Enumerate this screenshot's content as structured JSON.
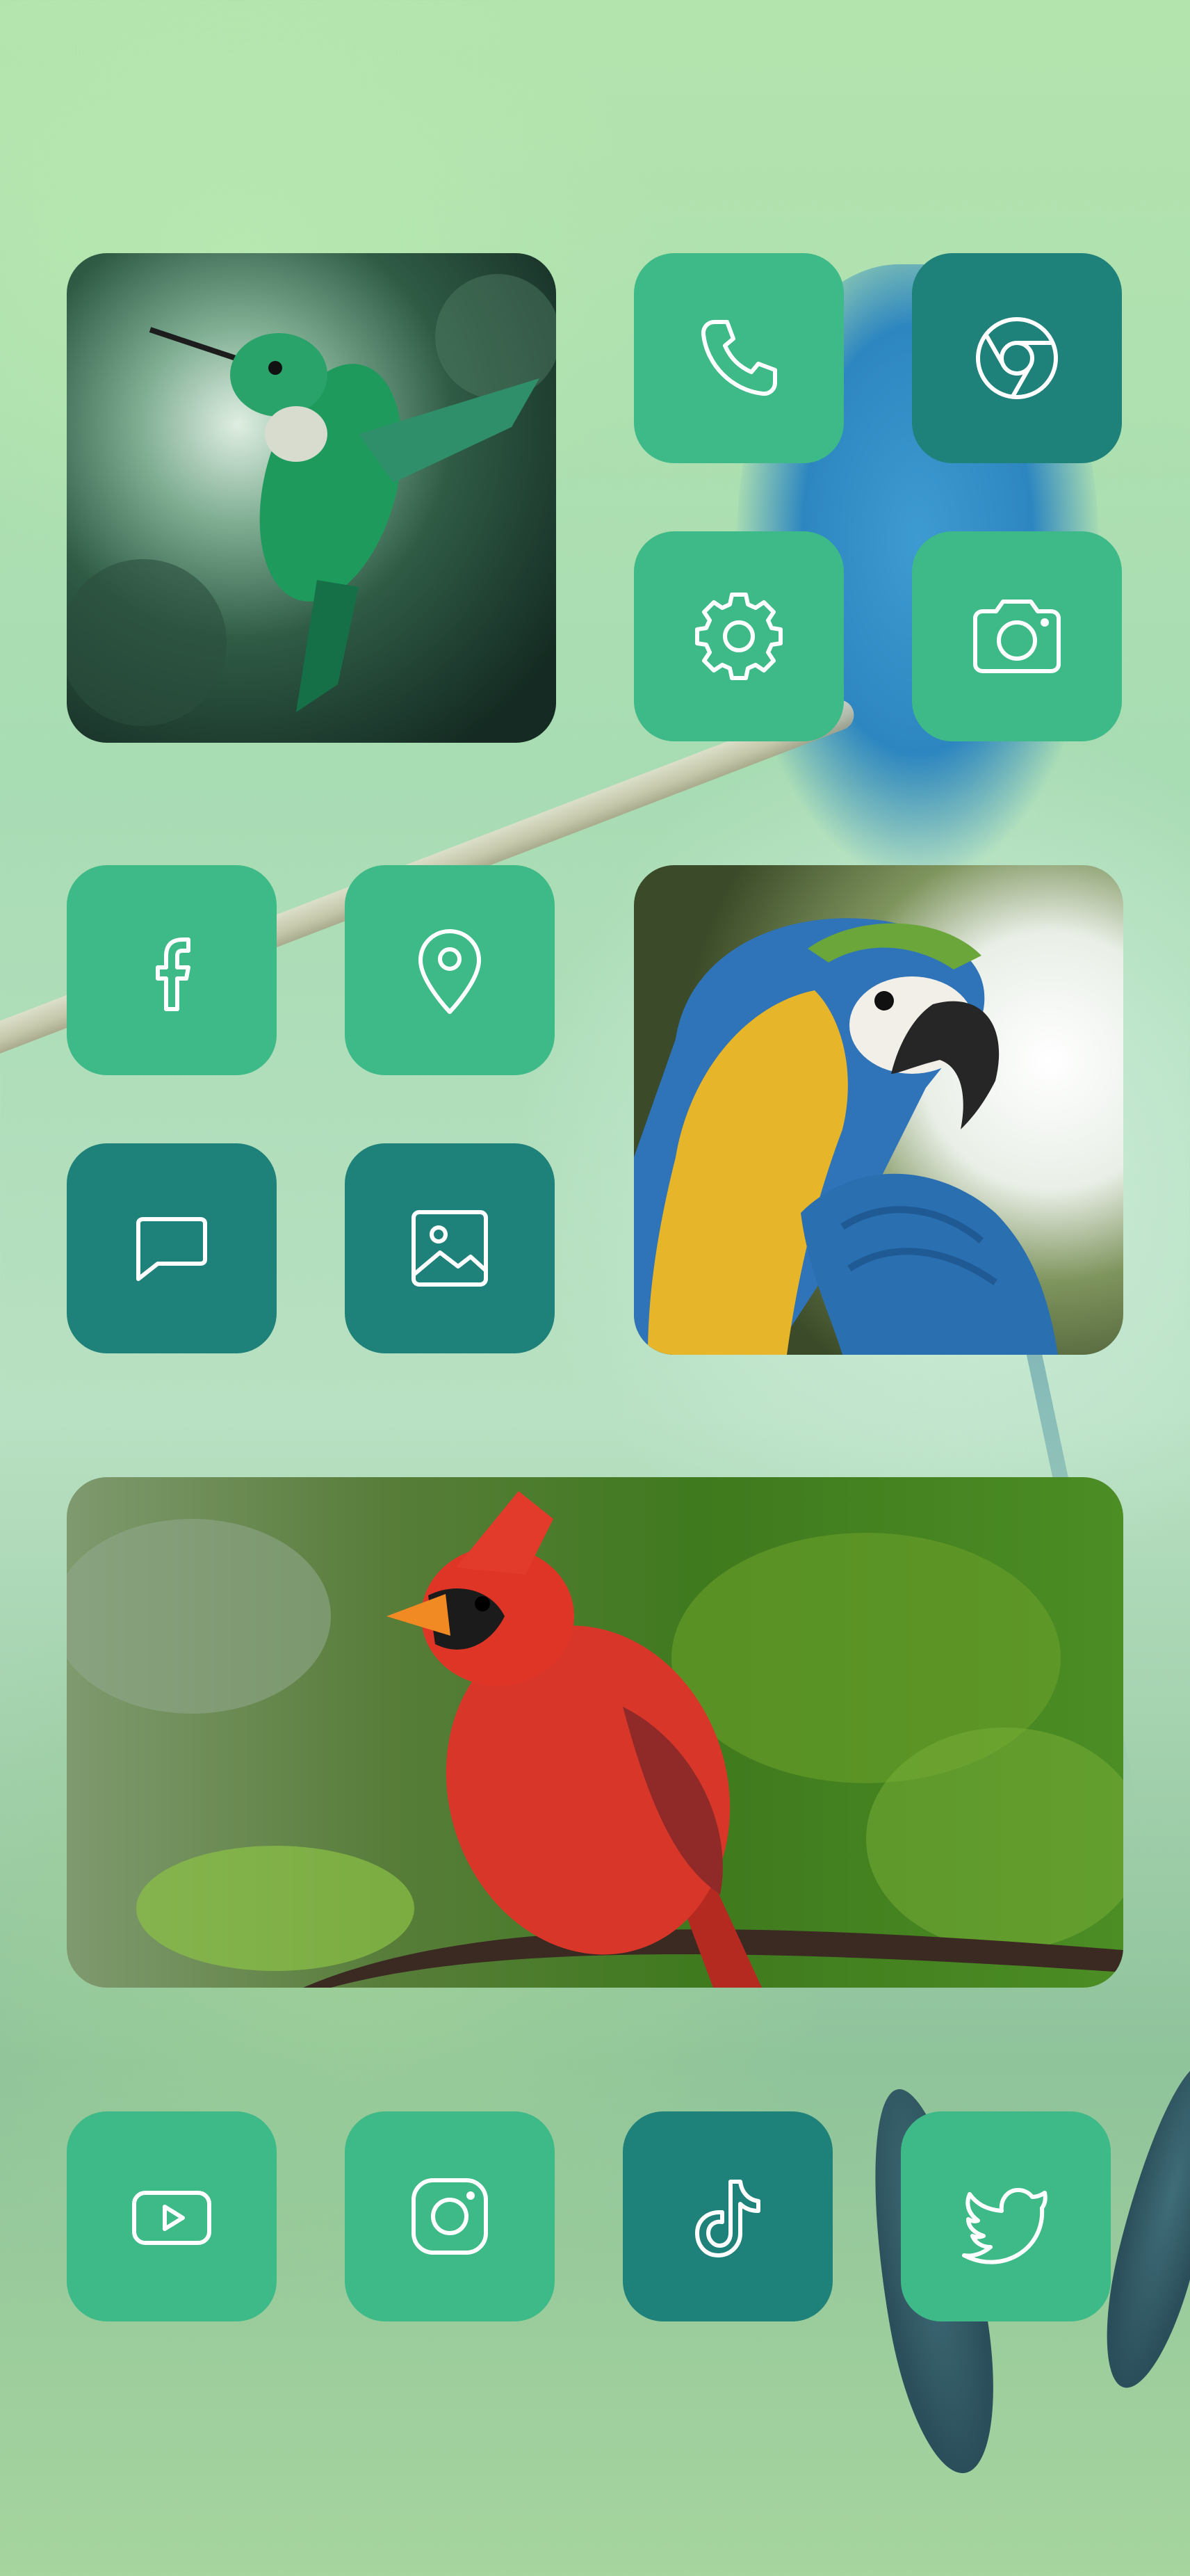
{
  "apps": [
    {
      "id": "phone",
      "icon": "phone-icon"
    },
    {
      "id": "chrome",
      "icon": "chrome-icon"
    },
    {
      "id": "settings",
      "icon": "gear-icon"
    },
    {
      "id": "camera",
      "icon": "camera-icon"
    },
    {
      "id": "facebook",
      "icon": "facebook-icon"
    },
    {
      "id": "maps",
      "icon": "map-pin-icon"
    },
    {
      "id": "messages",
      "icon": "chat-bubble-icon"
    },
    {
      "id": "gallery",
      "icon": "image-icon"
    },
    {
      "id": "youtube",
      "icon": "youtube-icon"
    },
    {
      "id": "instagram",
      "icon": "instagram-icon"
    },
    {
      "id": "tiktok",
      "icon": "tiktok-icon"
    },
    {
      "id": "twitter",
      "icon": "twitter-icon"
    }
  ],
  "widgets": [
    {
      "id": "hummingbird-photo"
    },
    {
      "id": "macaw-photo"
    },
    {
      "id": "cardinal-photo"
    }
  ],
  "colors": {
    "tile_light": "#3dba87",
    "tile_dark": "#1e827a",
    "icon_stroke": "#ffffff",
    "background": "#b4e4ad"
  }
}
